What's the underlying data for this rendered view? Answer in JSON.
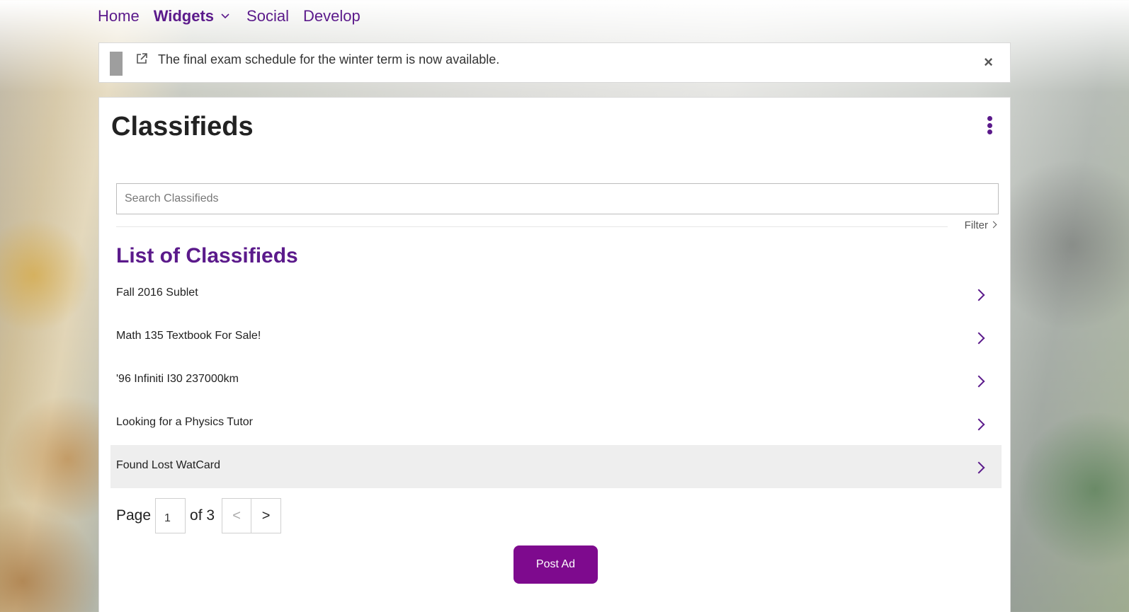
{
  "nav": {
    "items": [
      {
        "label": "Home",
        "active": false
      },
      {
        "label": "Widgets",
        "active": true,
        "has_dropdown": true
      },
      {
        "label": "Social",
        "active": false
      },
      {
        "label": "Develop",
        "active": false
      }
    ]
  },
  "notice": {
    "text": "The final exam schedule for the winter term is now available.",
    "icon": "external-link-icon",
    "close_label": "×"
  },
  "panel": {
    "title": "Classifieds",
    "menu_icon": "kebab-menu-icon",
    "search": {
      "placeholder": "Search Classifieds",
      "value": ""
    },
    "filter_label": "Filter",
    "list_heading": "List of Classifieds",
    "items": [
      {
        "label": "Fall 2016 Sublet",
        "highlighted": false
      },
      {
        "label": "Math 135 Textbook For Sale!",
        "highlighted": false
      },
      {
        "label": "'96 Infiniti I30 237000km",
        "highlighted": false
      },
      {
        "label": "Looking for a Physics Tutor",
        "highlighted": false
      },
      {
        "label": "Found Lost WatCard",
        "highlighted": true
      }
    ],
    "pager": {
      "page_label": "Page",
      "current_page": "1",
      "of_label": "of 3",
      "prev_label": "<",
      "next_label": ">"
    },
    "post_button_label": "Post Ad"
  },
  "colors": {
    "accent": "#5b1a8b",
    "button": "#7e0a8e",
    "highlight_row": "#eeeeee"
  }
}
